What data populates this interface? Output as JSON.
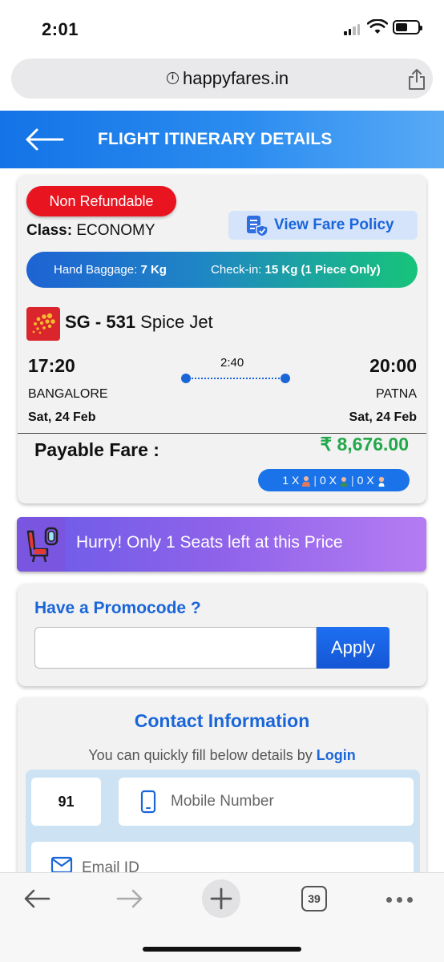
{
  "status_bar": {
    "time": "2:01"
  },
  "browser": {
    "url": "happyfares.in",
    "tab_count": "39"
  },
  "header": {
    "title": "FLIGHT ITINERARY DETAILS"
  },
  "itinerary": {
    "refund_badge": "Non Refundable",
    "class_label": "Class:",
    "class_value": "ECONOMY",
    "fare_policy_label": "View Fare Policy",
    "hand_baggage_label": "Hand Baggage:",
    "hand_baggage_value": "7 Kg",
    "checkin_label": "Check-in:",
    "checkin_value": "15 Kg (1 Piece Only)",
    "flight_code": "SG - 531",
    "airline": "Spice Jet",
    "departure_time": "17:20",
    "arrival_time": "20:00",
    "duration": "2:40",
    "departure_city": "BANGALORE",
    "arrival_city": "PATNA",
    "departure_date": "Sat, 24 Feb",
    "arrival_date": "Sat, 24 Feb",
    "payable_label": "Payable Fare :",
    "payable_amount": "₹ 8,676.00",
    "pax": {
      "adults": "1 X",
      "children": "0 X",
      "infants": "0 X"
    }
  },
  "alert": {
    "text": "Hurry! Only 1 Seats left at this Price"
  },
  "promo": {
    "heading": "Have a Promocode ?",
    "input_value": "",
    "apply_label": "Apply"
  },
  "contact": {
    "heading": "Contact Information",
    "subtext": "You can quickly fill below details by",
    "login_link": "Login",
    "country_code": "91",
    "mobile_placeholder": "Mobile Number",
    "email_placeholder": "Email ID"
  },
  "colors": {
    "brand_blue": "#1a66d9",
    "fare_green": "#22a84a",
    "badge_red": "#e8141f"
  }
}
